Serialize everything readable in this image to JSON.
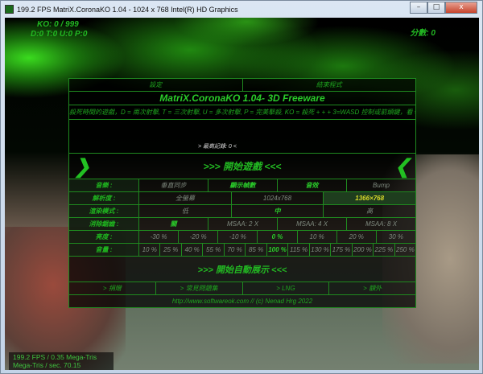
{
  "window": {
    "title": "199.2 FPS MatriX.CoronaKO 1.04 - 1024 x 768 Intel(R) HD Graphics",
    "minimize": "–",
    "maximize": "□",
    "close": "x"
  },
  "hud": {
    "ko": "KO: 0 / 999",
    "counters": "D:0 T:0 U:0 P:0",
    "score": "分數: 0"
  },
  "menu": {
    "top_buttons": [
      "設定",
      "結束程式"
    ],
    "title": "MatriX.CoronaKO 1.04- 3D Freeware",
    "scroll_text": "殺死時間的遊戲，D = 兩次射擊, T = 三次射擊, U = 多次射擊, P = 完美擊殺, KO = 殺死 + + + 3=WASD 控制或箭頭鍵，看 = 滑鼠",
    "record": "> 最高記錄: 0 <",
    "start_game": ">>> 開始遊戲 <<<",
    "arrow_left": "❯",
    "arrow_right": "❮",
    "options": [
      {
        "label": "音樂 :",
        "values": [
          "垂直同步",
          "顯示幀數",
          "音效",
          "Bump"
        ]
      },
      {
        "label": "解析度 :",
        "values": [
          "全螢幕",
          "1024x768",
          "1366×768"
        ],
        "selected": "1366×768"
      },
      {
        "label": "渲染模式 :",
        "values": [
          "低",
          "中",
          "高"
        ],
        "selected": "中"
      },
      {
        "label": "消除鋸齒 :",
        "values": [
          "關",
          "MSAA: 2 X",
          "MSAA: 4 X",
          "MSAA: 8 X"
        ],
        "selected": "關"
      },
      {
        "label": "亮度 :",
        "values": [
          "-30 %",
          "-20 %",
          "-10 %",
          "0 %",
          "10 %",
          "20 %",
          "30 %"
        ],
        "selected": "0 %"
      },
      {
        "label": "音量 :",
        "values": [
          "10 %",
          "25 %",
          "40 %",
          "55 %",
          "70 %",
          "85 %",
          "100 %",
          "115 %",
          "130 %",
          "175 %",
          "200 %",
          "225 %",
          "250 %"
        ],
        "selected": "100 %"
      }
    ],
    "auto_demo": ">>> 開始自動展示 <<<",
    "links": [
      "> 捐贈",
      "> 常見問題集",
      "> LNG",
      "> 額外"
    ],
    "url": "http://www.softwareok.com // (c) Nenad Hrg 2022"
  },
  "stats": {
    "line1": "199.2 FPS / 0.35 Mega-Tris",
    "line2": "Mega-Tris / sec. 70.15"
  }
}
